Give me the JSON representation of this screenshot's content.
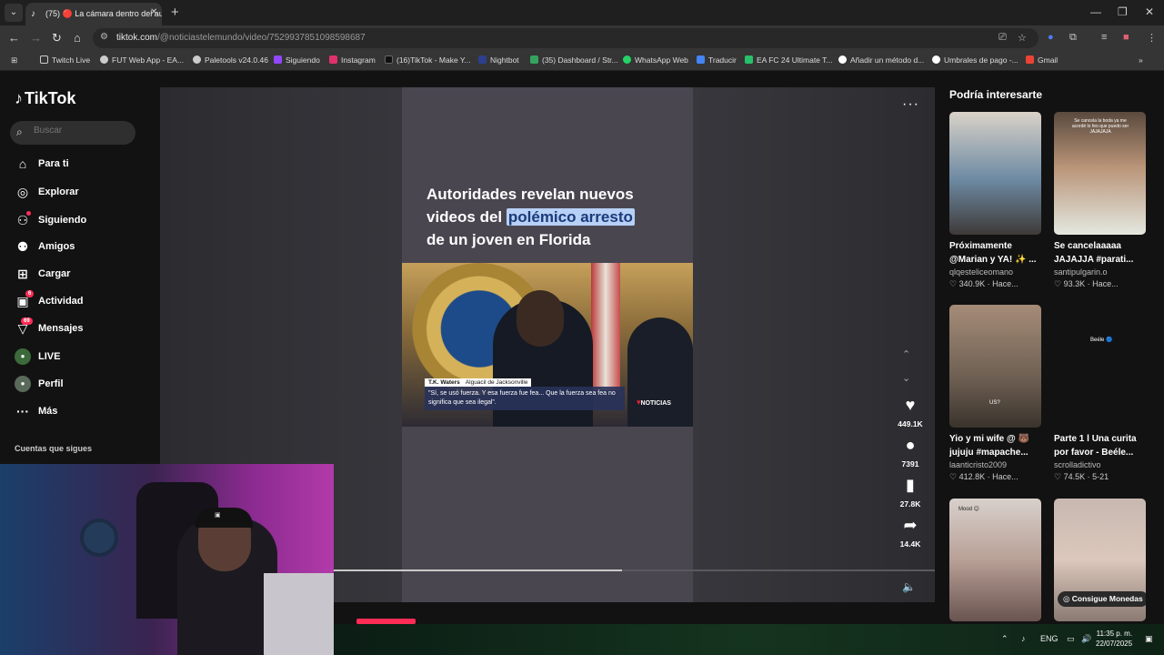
{
  "browser": {
    "tab_title": "(75) 🔴 La cámara dentro del au",
    "tab_close": "✕",
    "new_tab": "+",
    "url_host": "tiktok.com",
    "url_path": "/@noticiastelemundo/video/7529937851098598687",
    "window": {
      "minimize": "—",
      "restore": "❐",
      "close": "✕"
    }
  },
  "bookmarks": [
    {
      "label": "Twitch Live",
      "color": "#9a9a9a"
    },
    {
      "label": "FUT Web App - EA...",
      "color": "#cccccc"
    },
    {
      "label": "Paletools v24.0.46",
      "color": "#cccccc"
    },
    {
      "label": "Siguiendo",
      "color": "#9147ff"
    },
    {
      "label": "Instagram",
      "color": "#e1306c"
    },
    {
      "label": "(16)TikTok - Make Y...",
      "color": "#111111"
    },
    {
      "label": "Nightbot",
      "color": "#2d3f8c"
    },
    {
      "label": "(35) Dashboard / Str...",
      "color": "#35a35f"
    },
    {
      "label": "WhatsApp Web",
      "color": "#25d366"
    },
    {
      "label": "Traducir",
      "color": "#4285f4"
    },
    {
      "label": "EA FC 24 Ultimate T...",
      "color": "#28c06a"
    },
    {
      "label": "Añadir un método d...",
      "color": "#ffffff"
    },
    {
      "label": "Umbrales de pago -...",
      "color": "#ffffff"
    },
    {
      "label": "Gmail",
      "color": "#ea4335"
    }
  ],
  "tiktok": {
    "logo": "TikTok",
    "search_placeholder": "Buscar",
    "nav": [
      {
        "label": "Para ti",
        "icon": "home-icon",
        "glyph": "⌂"
      },
      {
        "label": "Explorar",
        "icon": "compass-icon",
        "glyph": "◎"
      },
      {
        "label": "Siguiendo",
        "icon": "following-icon",
        "glyph": "⚇"
      },
      {
        "label": "Amigos",
        "icon": "friends-icon",
        "glyph": "⚉"
      },
      {
        "label": "Cargar",
        "icon": "upload-icon",
        "glyph": "⊞"
      },
      {
        "label": "Actividad",
        "icon": "activity-icon",
        "glyph": "▣",
        "badge": "6"
      },
      {
        "label": "Mensajes",
        "icon": "messages-icon",
        "glyph": "▽",
        "badge": "69"
      },
      {
        "label": "LIVE",
        "icon": "live-icon",
        "glyph": "●"
      },
      {
        "label": "Perfil",
        "icon": "profile-icon",
        "glyph": "●"
      },
      {
        "label": "Más",
        "icon": "more-icon",
        "glyph": "···"
      }
    ],
    "following_title": "Cuentas que sigues"
  },
  "video": {
    "headline_1": "Autoridades revelan nuevos",
    "headline_2a": "videos del ",
    "headline_2b": "polémico arresto",
    "headline_3": "de un joven en Florida",
    "name_tag": "T.K. Waters",
    "name_role": "Alguacil de Jacksonville",
    "quote": "\"Sí, se usó fuerza. Y esa fuerza fue fea... Que la fuerza sea fea no significa que sea ilegal\".",
    "network": "NOTICIAS",
    "likes": "449.1K",
    "comments": "7391",
    "saves": "27.8K",
    "shares": "14.4K",
    "progress": 0.48
  },
  "recommended": {
    "title": "Podría interesarte",
    "items": [
      {
        "caption1": "Próximamente",
        "caption2": "@Marian y YA! ✨ ...",
        "user": "qlqesteliceomano",
        "meta": "♡ 340.9K · Hace...",
        "bg": "linear-gradient(180deg,#d9d2c8,#6d8aa3 55%,#3e3a38)"
      },
      {
        "caption1": "Se cancelaaaaa",
        "caption2": "JAJAJJA #parati...",
        "user": "santipulgarin.o",
        "meta": "♡ 93.3K · Hace...",
        "bg": "linear-gradient(180deg,#5a4a3e,#b99478 45%,#e4e8e0)",
        "thumb_text": "Se cancela la boda ya me acordé lo feo que puedo ser JAJAJAJA"
      },
      {
        "caption1": "Yio y mi wife @ 🐻",
        "caption2": "jujuju #mapache...",
        "user": "laanticristo2009",
        "meta": "♡ 412.8K · Hace...",
        "bg": "linear-gradient(180deg,#a68c78,#6d5f52 60%,#3a332c)",
        "thumb_text": "US?"
      },
      {
        "caption1": "Parte 1 l Una curita",
        "caption2": "por favor - Beéle...",
        "user": "scrolladictivo",
        "meta": "♡ 74.5K · 5-21",
        "bg": "#121212",
        "thumb_text": "Beéle 🔵"
      },
      {
        "caption1": "",
        "caption2": "",
        "user": "",
        "meta": "",
        "bg": "linear-gradient(180deg,#d8d0cc,#b8a096 50%,#6a5450)",
        "thumb_text": "Mood 😊"
      },
      {
        "caption1": "",
        "caption2": "",
        "user": "",
        "meta": "",
        "bg": "linear-gradient(180deg,#c7b8b0,#dcc8bc 50%,#8a7a72)"
      }
    ],
    "coins_button": "Consigue Monedas"
  },
  "taskbar": {
    "lang": "ENG",
    "time": "11:35 p. m.",
    "date": "22/07/2025"
  }
}
